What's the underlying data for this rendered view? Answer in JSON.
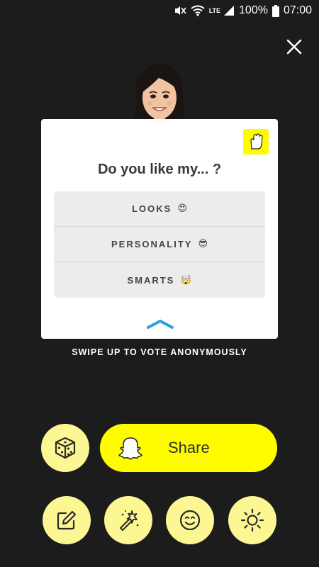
{
  "status_bar": {
    "network": "LTE",
    "battery": "100%",
    "time": "07:00"
  },
  "card": {
    "question": "Do you like my... ?",
    "options": [
      {
        "label": "LOOKS",
        "emoji": "😍"
      },
      {
        "label": "PERSONALITY",
        "emoji": "😎"
      },
      {
        "label": "SMARTS",
        "emoji": "🤯"
      }
    ]
  },
  "swipe_hint": "SWIPE UP TO VOTE ANONYMOUSLY",
  "actions": {
    "share_label": "Share"
  },
  "colors": {
    "background": "#1c1c1c",
    "snap_yellow": "#fffc00",
    "light_yellow": "#fdf793",
    "chevron_blue": "#2f9fd8"
  }
}
